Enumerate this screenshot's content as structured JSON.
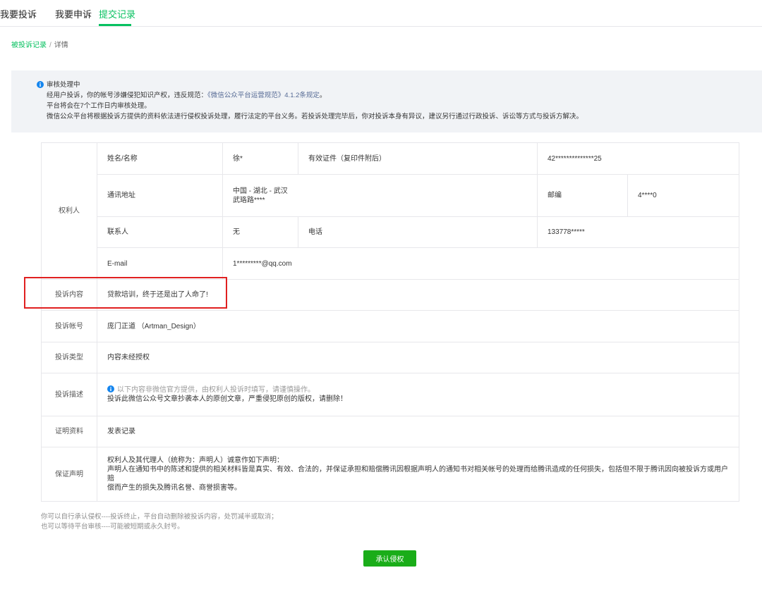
{
  "tabs": [
    {
      "label": "我要投诉"
    },
    {
      "label": "我要申诉"
    },
    {
      "label": "提交记录"
    }
  ],
  "breadcrumb": {
    "link": "被投诉记录",
    "separator": "/",
    "current": "详情"
  },
  "notice": {
    "title": "审核处理中",
    "line1_prefix": "经用户投诉，你的帐号涉嫌侵犯知识产权，违反规范：",
    "line1_link": "《微信公众平台运营规范》4.1.2条规定",
    "line1_suffix": "。",
    "line2": "平台将会在7个工作日内审核处理。",
    "line3": "微信公众平台将根据投诉方提供的资料依法进行侵权投诉处理，履行法定的平台义务。若投诉处理完毕后，你对投诉本身有异议，建议另行通过行政投诉、诉讼等方式与投诉方解决。"
  },
  "table": {
    "rightholder": {
      "label": "权利人",
      "name_label": "姓名/名称",
      "name_value": "徐*",
      "id_label": "有效证件（复印件附后）",
      "id_value": "42**************25",
      "address_label": "通讯地址",
      "address_line1": "中国 - 湖北 - 武汉",
      "address_line2": "武珞路****",
      "zip_label": "邮编",
      "zip_value": "4****0",
      "contact_label": "联系人",
      "contact_value": "无",
      "phone_label": "电话",
      "phone_value": "133778*****",
      "email_label": "E-mail",
      "email_value": "1*********@qq.com"
    },
    "content_label": "投诉内容",
    "content_value": "贷款培训，终于还是出了人命了!",
    "account_label": "投诉帐号",
    "account_value": "庞门正道 （Artman_Design）",
    "type_label": "投诉类型",
    "type_value": "内容未经授权",
    "desc_label": "投诉描述",
    "desc_tip": "以下内容非微信官方提供，由权利人投诉时填写，请谨慎操作。",
    "desc_value": "投诉此微信公众号文章抄袭本人的原创文章，严重侵犯原创的版权，请删除！",
    "proof_label": "证明资料",
    "proof_value": "发表记录",
    "guarantee_label": "保证声明",
    "guarantee_line1": "权利人及其代理人（统称为：声明人）诚意作如下声明：",
    "guarantee_line2": "声明人在通知书中的陈述和提供的相关材料皆是真实、有效、合法的，并保证承担和赔偿腾讯因根据声明人的通知书对相关帐号的处理而给腾讯造成的任何损失，包括但不限于腾讯因向被投诉方或用户赔",
    "guarantee_line3": "偿而产生的损失及腾讯名誉、商誉损害等。"
  },
  "footer": {
    "line1": "你可以自行承认侵权----投诉终止，平台自动删除被投诉内容，处罚减半或取消；",
    "line2": "也可以等待平台审核----可能被短期或永久封号。"
  },
  "confirm_button": "承认侵权",
  "colors": {
    "accent": "#07c160",
    "button": "#1aad19",
    "link": "#576b95",
    "info": "#1485ee",
    "highlight": "#e02020"
  }
}
